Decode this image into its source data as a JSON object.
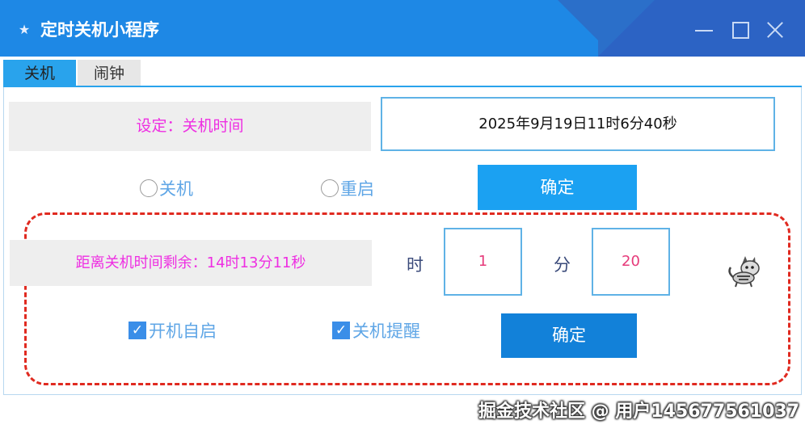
{
  "window": {
    "title": "定时关机小程序"
  },
  "tabs": [
    {
      "label": "关机",
      "active": true
    },
    {
      "label": "闹钟",
      "active": false
    }
  ],
  "shutdown": {
    "set_label": "设定：关机时间",
    "datetime_value": "2025年9月19日11时6分40秒",
    "radio_shutdown": "关机",
    "radio_restart": "重启",
    "confirm_1": "确定",
    "remaining_label": "距离关机时间剩余：14时13分11秒",
    "hour_unit": "时",
    "hours_value": "1",
    "minute_unit": "分",
    "minutes_value": "20",
    "check_autostart": "开机自启",
    "check_autostart_checked": true,
    "check_remind": "关机提醒",
    "check_remind_checked": true,
    "confirm_2": "确定"
  },
  "watermark": "掘金技术社区 @ 用户145677561037",
  "colors": {
    "titlebar": "#1e88e5",
    "accent": "#1ba1f2",
    "label_text": "#ee2ee2",
    "dashed_border": "#e02a20"
  }
}
